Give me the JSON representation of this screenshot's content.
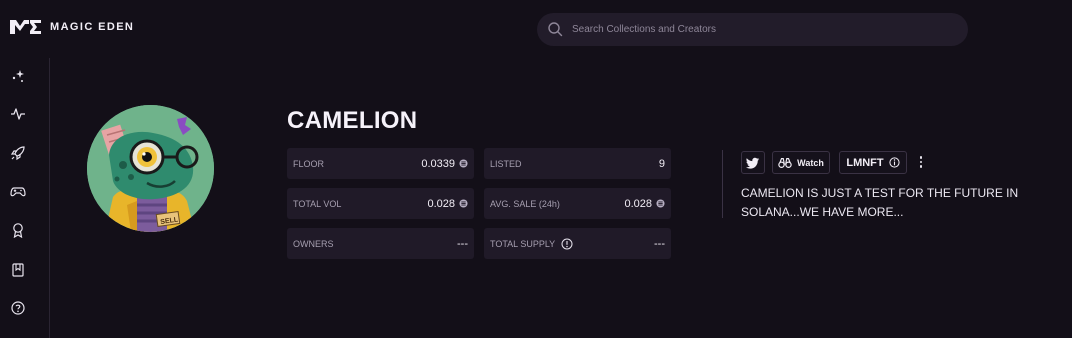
{
  "header": {
    "brand_text": "MAGIC EDEN",
    "search_placeholder": "Search Collections and Creators"
  },
  "sidebar": {
    "items": [
      {
        "icon": "sparkles-icon"
      },
      {
        "icon": "activity-icon"
      },
      {
        "icon": "rocket-icon"
      },
      {
        "icon": "gamepad-icon"
      },
      {
        "icon": "award-icon"
      },
      {
        "icon": "book-icon"
      },
      {
        "icon": "help-icon"
      }
    ]
  },
  "collection": {
    "title": "CAMELION",
    "stats": {
      "floor": {
        "label": "FLOOR",
        "value": "0.0339"
      },
      "listed": {
        "label": "LISTED",
        "value": "9"
      },
      "total_vol": {
        "label": "TOTAL VOL",
        "value": "0.028"
      },
      "avg_sale": {
        "label": "AVG. SALE (24h)",
        "value": "0.028"
      },
      "owners": {
        "label": "OWNERS",
        "value": "---"
      },
      "total_supply": {
        "label": "TOTAL SUPPLY",
        "value": "---"
      }
    },
    "actions": {
      "watch_label": "Watch",
      "lmnft_label": "LMNFT"
    },
    "description": "CAMELION IS JUST A TEST FOR THE FUTURE IN SOLANA...WE HAVE MORE..."
  },
  "colors": {
    "background": "#130f18",
    "stat_card": "#201a28",
    "search_bg": "#221c2a",
    "avatar_bg": "#6fb38b"
  }
}
